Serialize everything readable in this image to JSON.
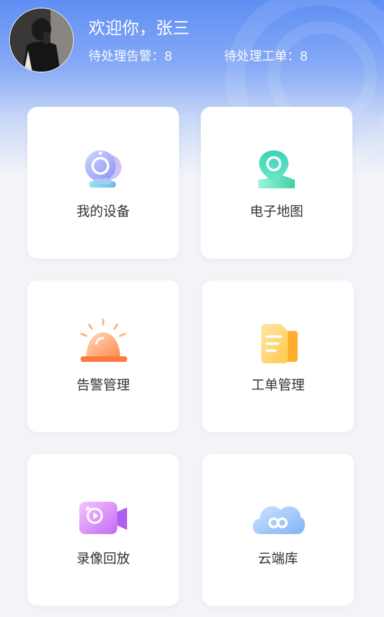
{
  "header": {
    "welcome": "欢迎你，张三",
    "pending_alarms": "待处理告警：8",
    "pending_orders": "待处理工单：8"
  },
  "menu": [
    {
      "label": "我的设备",
      "icon": "camera-icon"
    },
    {
      "label": "电子地图",
      "icon": "map-pin-icon"
    },
    {
      "label": "告警管理",
      "icon": "alarm-light-icon"
    },
    {
      "label": "工单管理",
      "icon": "document-icon"
    },
    {
      "label": "录像回放",
      "icon": "video-replay-icon"
    },
    {
      "label": "云端库",
      "icon": "cloud-icon"
    }
  ],
  "colors": {
    "header_blue": "#5f8ef4",
    "page_bg": "#f3f4f7",
    "card_bg": "#ffffff",
    "text": "#333333"
  }
}
